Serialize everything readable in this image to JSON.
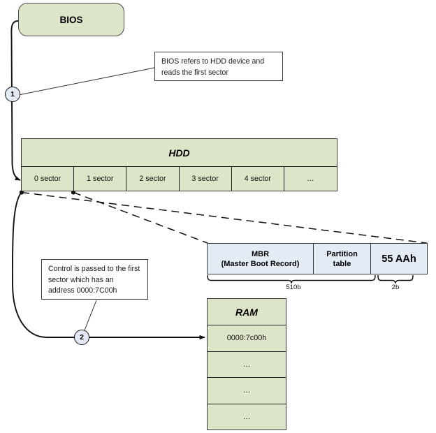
{
  "diagram": {
    "title": "BIOS boot sequence to MBR and RAM",
    "colors": {
      "green_fill": "#dde5c8",
      "blue_fill": "#e4ebf5",
      "stroke": "#3a3a3a",
      "circle_fill": "#e3e9f5"
    }
  },
  "bios": {
    "label": "BIOS"
  },
  "notes": {
    "bios_note": "BIOS refers to HDD device and reads the first sector",
    "control_note": "Control is passed to the first sector which has an address 0000:7C00h"
  },
  "steps": [
    {
      "number": "1"
    },
    {
      "number": "2"
    }
  ],
  "hdd": {
    "title": "HDD",
    "sectors": [
      "0 sector",
      "1 sector",
      "2 sector",
      "3 sector",
      "4 sector",
      "…"
    ]
  },
  "mbr": {
    "cells": [
      "MBR\n(Master Boot Record)",
      "Partition\ntable",
      "55 AAh"
    ],
    "cell_0_line_1": "MBR",
    "cell_0_line_2": "(Master Boot Record)",
    "cell_1_line_1": "Partition",
    "cell_1_line_2": "table",
    "cell_2": "55 AAh",
    "size_left": "510b",
    "size_right": "2b"
  },
  "ram": {
    "title": "RAM",
    "rows": [
      "0000:7c00h",
      "…",
      "…",
      "…"
    ]
  }
}
